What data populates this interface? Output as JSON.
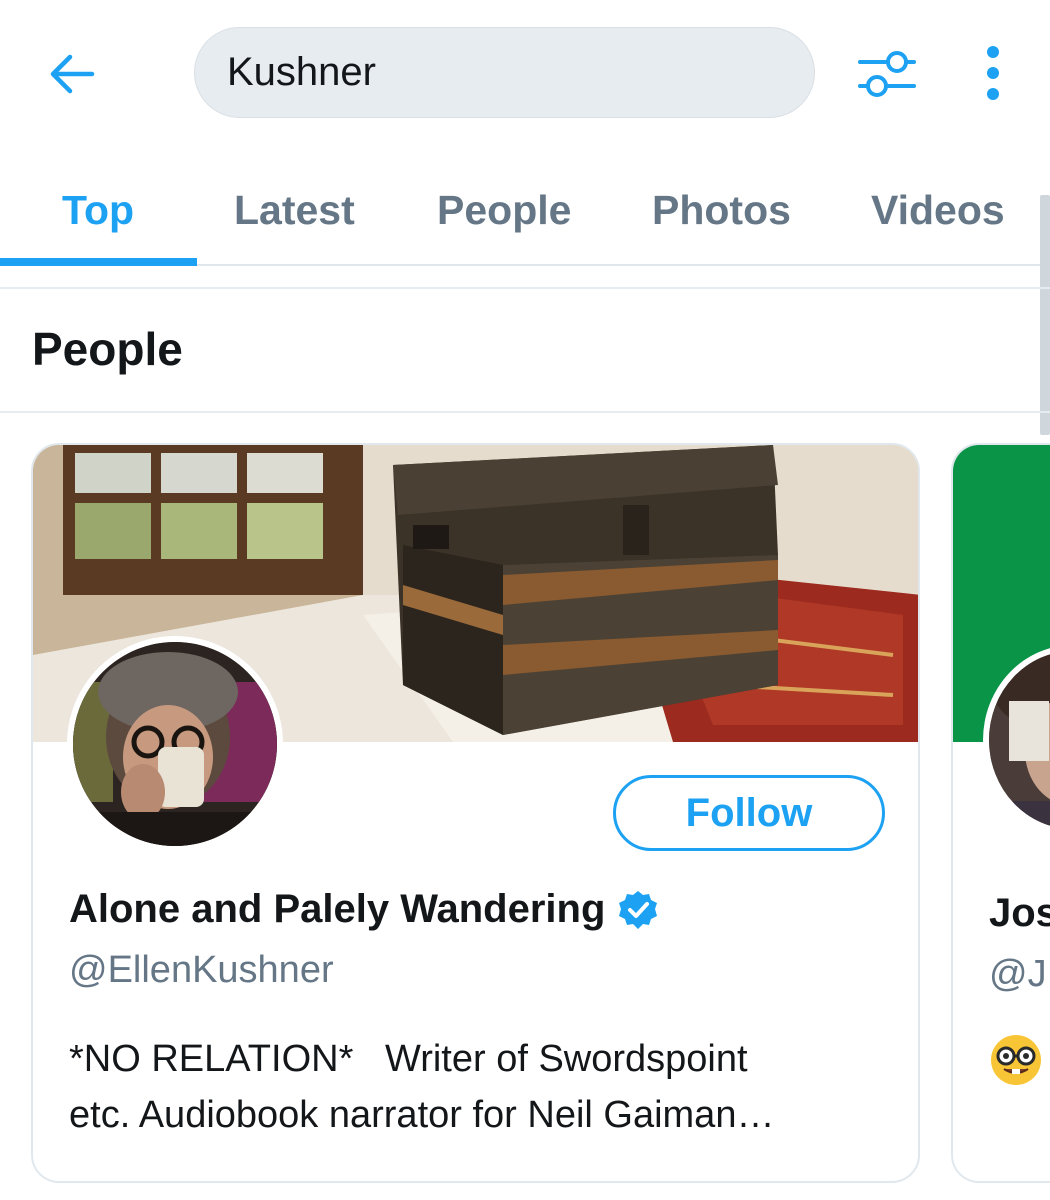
{
  "search": {
    "query": "Kushner"
  },
  "toolbar": {
    "back_icon": "arrow-left-icon",
    "filter_icon": "sliders-icon",
    "more_icon": "more-vertical-icon"
  },
  "tabs": [
    {
      "label": "Top",
      "active": true
    },
    {
      "label": "Latest",
      "active": false
    },
    {
      "label": "People",
      "active": false
    },
    {
      "label": "Photos",
      "active": false
    },
    {
      "label": "Videos",
      "active": false
    }
  ],
  "section": {
    "title": "People"
  },
  "cards": [
    {
      "name": "Alone and Palely Wandering",
      "verified": true,
      "handle": "@EllenKushner",
      "bio_line1": "*NO RELATION*   Writer of Swordspoint",
      "bio_line2": "etc. Audiobook narrator for Neil Gaiman…",
      "follow_label": "Follow"
    },
    {
      "name": "Jos",
      "handle": "@J",
      "bio_emoji": "nerd-face-emoji"
    }
  ],
  "colors": {
    "accent": "#1da1f2",
    "secondary_text": "#657786",
    "primary_text": "#14171a",
    "search_bg": "#e6ecf0",
    "card2_banner": "#0a9447"
  }
}
